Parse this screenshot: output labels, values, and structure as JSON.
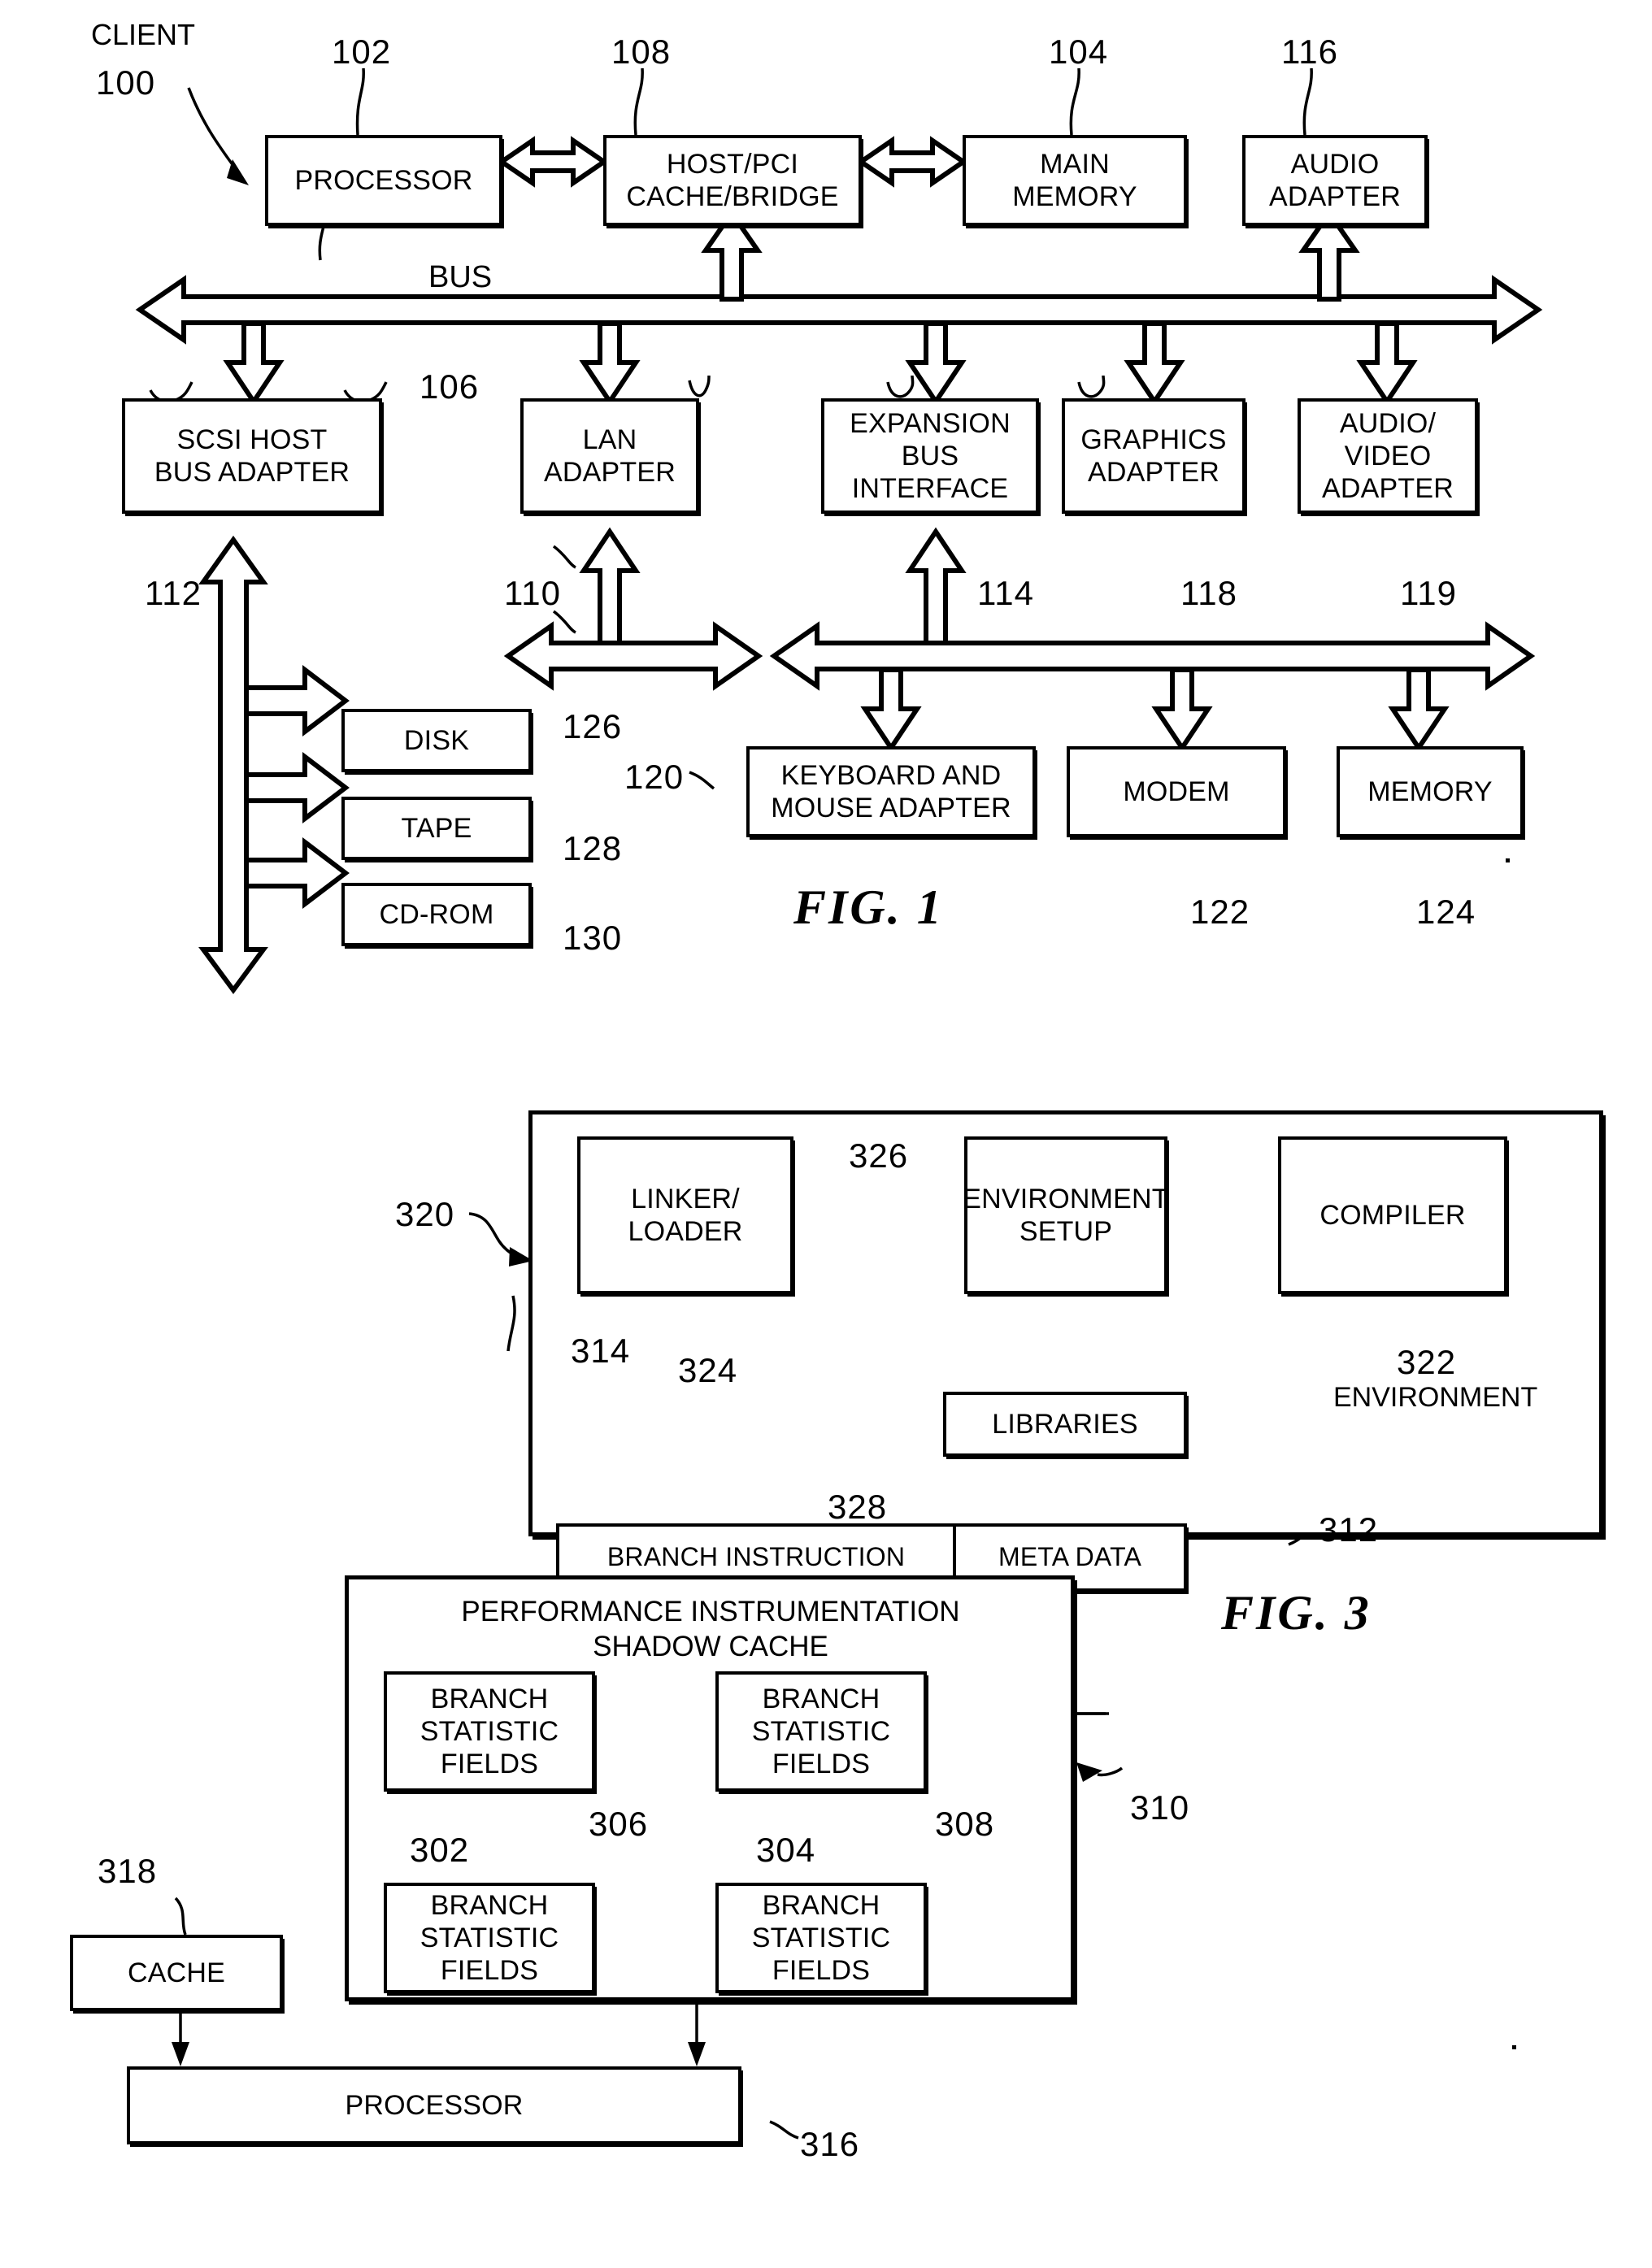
{
  "document": {
    "type": "patent-drawing-sheet",
    "figures": [
      "FIG. 1",
      "FIG. 3"
    ]
  },
  "fig1": {
    "caption": "FIG. 1",
    "client_label": "CLIENT",
    "client_ref": "100",
    "bus_label": "BUS",
    "boxes": [
      {
        "id": "processor",
        "label": "PROCESSOR",
        "ref": "102"
      },
      {
        "id": "host_pci",
        "label": "HOST/PCI\nCACHE/BRIDGE",
        "ref": "108"
      },
      {
        "id": "main_memory",
        "label": "MAIN\nMEMORY",
        "ref": "104"
      },
      {
        "id": "audio_adapter",
        "label": "AUDIO\nADAPTER",
        "ref": "116"
      },
      {
        "id": "scsi",
        "label": "SCSI HOST\nBUS ADAPTER",
        "ref": "112"
      },
      {
        "id": "lan",
        "label": "LAN\nADAPTER",
        "ref": "110"
      },
      {
        "id": "expansion",
        "label": "EXPANSION\nBUS\nINTERFACE",
        "ref": "114"
      },
      {
        "id": "graphics",
        "label": "GRAPHICS\nADAPTER",
        "ref": "118"
      },
      {
        "id": "audio_video",
        "label": "AUDIO/\nVIDEO\nADAPTER",
        "ref": "119"
      },
      {
        "id": "disk",
        "label": "DISK",
        "ref": "126"
      },
      {
        "id": "tape",
        "label": "TAPE",
        "ref": "128"
      },
      {
        "id": "cdrom",
        "label": "CD-ROM",
        "ref": "130"
      },
      {
        "id": "kbd_mouse",
        "label": "KEYBOARD AND\nMOUSE ADAPTER",
        "ref": "120"
      },
      {
        "id": "modem",
        "label": "MODEM",
        "ref": "122"
      },
      {
        "id": "memory",
        "label": "MEMORY",
        "ref": "124"
      }
    ],
    "bus_ref": "106"
  },
  "fig3": {
    "caption": "FIG. 3",
    "environment_box": {
      "label": "ENVIRONMENT",
      "ref": "320"
    },
    "boxes": [
      {
        "id": "linker_loader",
        "label": "LINKER/\nLOADER",
        "ref": "324"
      },
      {
        "id": "environment_setup",
        "label": "ENVIRONMENT\nSETUP",
        "ref": "326"
      },
      {
        "id": "compiler",
        "label": "COMPILER",
        "ref": "322"
      },
      {
        "id": "libraries",
        "label": "LIBRARIES",
        "ref": "328"
      },
      {
        "id": "branch_instruction",
        "label": "BRANCH INSTRUCTION",
        "ref": "314"
      },
      {
        "id": "meta_data",
        "label": "META DATA",
        "ref": "312"
      }
    ],
    "shadow_cache": {
      "title": "PERFORMANCE INSTRUMENTATION\nSHADOW CACHE",
      "ref": "310",
      "fields": [
        {
          "id": "bsf_302",
          "label": "BRANCH\nSTATISTIC FIELDS",
          "ref": "302"
        },
        {
          "id": "bsf_304",
          "label": "BRANCH\nSTATISTIC FIELDS",
          "ref": "304"
        },
        {
          "id": "bsf_306",
          "label": "BRANCH\nSTATISTIC FIELDS",
          "ref": "306"
        },
        {
          "id": "bsf_308",
          "label": "BRANCH\nSTATISTIC FIELDS",
          "ref": "308"
        }
      ]
    },
    "cache": {
      "label": "CACHE",
      "ref": "318"
    },
    "processor": {
      "label": "PROCESSOR",
      "ref": "316"
    }
  },
  "colors": {
    "ink": "#000000",
    "paper": "#ffffff"
  }
}
